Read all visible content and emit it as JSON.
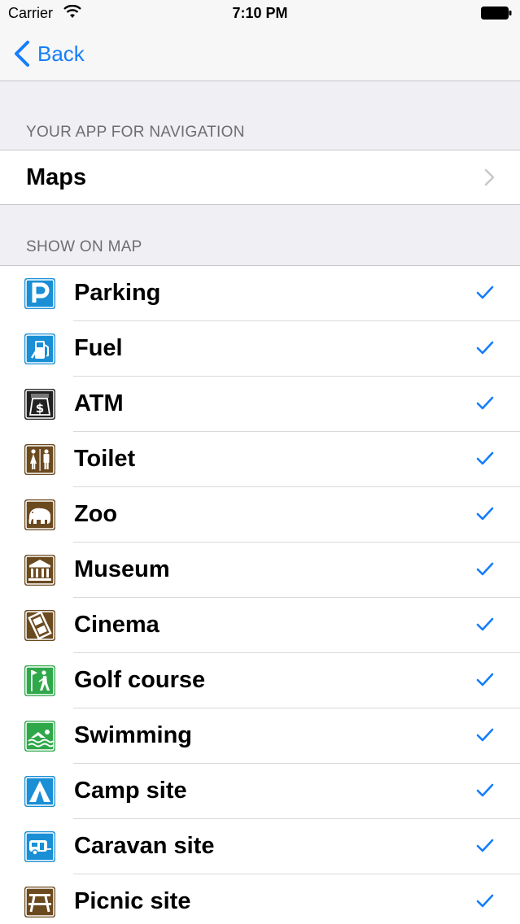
{
  "status_bar": {
    "carrier": "Carrier",
    "time": "7:10 PM"
  },
  "nav": {
    "back_label": "Back"
  },
  "sections": {
    "navigation_header": "YOUR APP FOR NAVIGATION",
    "navigation_app": "Maps",
    "map_header": "SHOW ON MAP"
  },
  "poi_items": [
    {
      "label": "Parking",
      "icon": "parking-icon",
      "color": "#1a8fd6",
      "checked": true
    },
    {
      "label": "Fuel",
      "icon": "fuel-pump-icon",
      "color": "#1a8fd6",
      "checked": true
    },
    {
      "label": "ATM",
      "icon": "atm-icon",
      "color": "#222222",
      "checked": true
    },
    {
      "label": "Toilet",
      "icon": "toilet-icon",
      "color": "#6b4a1f",
      "checked": true
    },
    {
      "label": "Zoo",
      "icon": "elephant-icon",
      "color": "#6b4a1f",
      "checked": true
    },
    {
      "label": "Museum",
      "icon": "museum-icon",
      "color": "#6b4a1f",
      "checked": true
    },
    {
      "label": "Cinema",
      "icon": "film-strip-icon",
      "color": "#6b4a1f",
      "checked": true
    },
    {
      "label": "Golf course",
      "icon": "golf-icon",
      "color": "#2fa84a",
      "checked": true
    },
    {
      "label": "Swimming",
      "icon": "swimmer-icon",
      "color": "#2fa84a",
      "checked": true
    },
    {
      "label": "Camp site",
      "icon": "tent-icon",
      "color": "#1a8fd6",
      "checked": true
    },
    {
      "label": "Caravan site",
      "icon": "caravan-icon",
      "color": "#1a8fd6",
      "checked": true
    },
    {
      "label": "Picnic site",
      "icon": "picnic-table-icon",
      "color": "#6b4a1f",
      "checked": true
    }
  ],
  "colors": {
    "accent": "#157efb",
    "background": "#efeff4",
    "section_header": "#6d6d72"
  }
}
